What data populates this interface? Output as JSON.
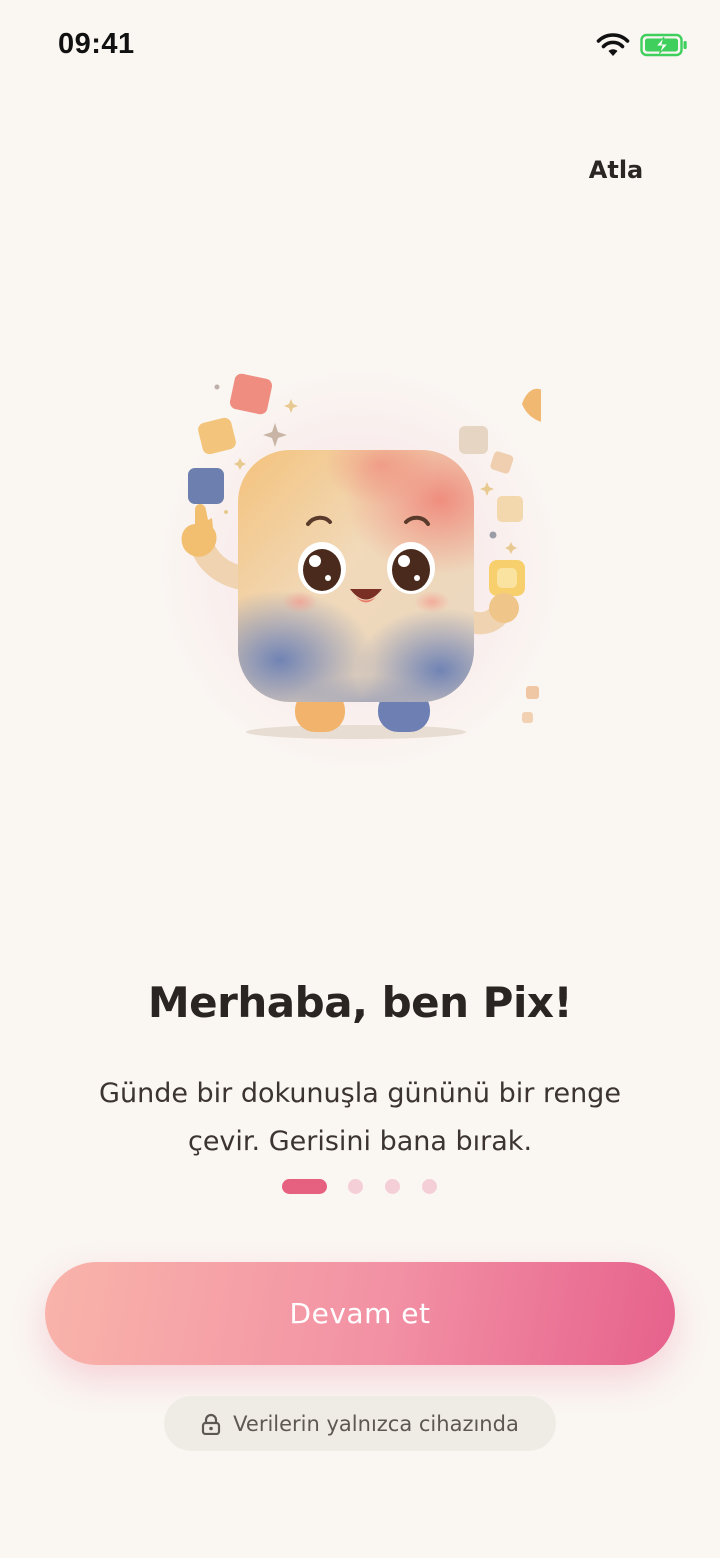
{
  "status_bar": {
    "time": "09:41",
    "icons": [
      "wifi-icon",
      "battery-charging-icon"
    ],
    "battery_color": "#3fcf5c"
  },
  "header": {
    "skip_label": "Atla"
  },
  "hero": {
    "illustration": "pix-mascot-illustration"
  },
  "content": {
    "title": "Merhaba, ben Pix!",
    "subtitle_lines": [
      "Günde bir dokunuşla gününü bir renge",
      "çevir. Gerisini bana bırak."
    ]
  },
  "pager": {
    "total": 4,
    "current": 1,
    "active_color": "#e6607f",
    "inactive_color": "#f5cfd8"
  },
  "cta": {
    "label": "Devam et",
    "gradient": [
      "#f9b4aa",
      "#e6618c"
    ]
  },
  "privacy": {
    "icon": "lock-icon",
    "label": "Verilerin yalnızca cihazında"
  },
  "colors": {
    "background": "#faf6f2",
    "text": "#2a2422"
  }
}
